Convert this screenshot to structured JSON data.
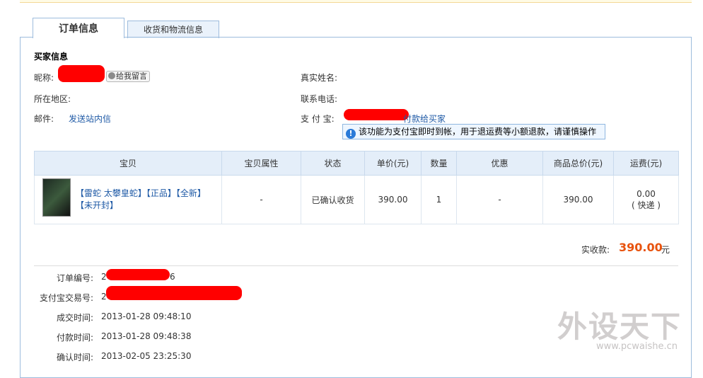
{
  "tabs": {
    "order_info": "订单信息",
    "shipping_info": "收货和物流信息"
  },
  "buyer": {
    "section_title": "买家信息",
    "nickname_label": "昵称:",
    "leave_message": "给我留言",
    "region_label": "所在地区:",
    "email_label": "邮件:",
    "send_message": "发送站内信",
    "real_name_label": "真实姓名:",
    "phone_label": "联系电话:",
    "alipay_label": "支 付 宝:",
    "pay_to_buyer": "付款给买家",
    "tip": "该功能为支付宝即时到帐，用于退运费等小额退款，请谨慎操作"
  },
  "table": {
    "headers": [
      "宝贝",
      "宝贝属性",
      "状态",
      "单价(元)",
      "数量",
      "优惠",
      "商品总价(元)",
      "运费(元)"
    ],
    "row": {
      "title": "【雷蛇 太攀皇蛇】【正品】【全新】【未开封】",
      "attributes": "-",
      "status": "已确认收货",
      "unit_price": "390.00",
      "quantity": "1",
      "discount": "-",
      "total": "390.00",
      "shipping": "0.00",
      "shipping_method": "( 快递 )"
    }
  },
  "summary": {
    "label": "实收款:",
    "value": "390.00",
    "unit": "元"
  },
  "order": {
    "order_no_label": "订单编号:",
    "order_no_prefix": "2",
    "order_no_suffix": "6",
    "alipay_no_label": "支付宝交易号:",
    "alipay_no_prefix": "2",
    "deal_time_label": "成交时间:",
    "deal_time": "2013-01-28 09:48:10",
    "pay_time_label": "付款时间:",
    "pay_time": "2013-01-28 09:48:38",
    "confirm_time_label": "确认时间:",
    "confirm_time": "2013-02-05 23:25:30"
  },
  "watermark": {
    "text": "外设天下",
    "url": "www.pcwaishe.cn"
  },
  "colors": {
    "accent_price": "#e8530e",
    "link": "#1f5aa6",
    "redaction": "#ff0000",
    "header_bg": "#e4eef9"
  }
}
